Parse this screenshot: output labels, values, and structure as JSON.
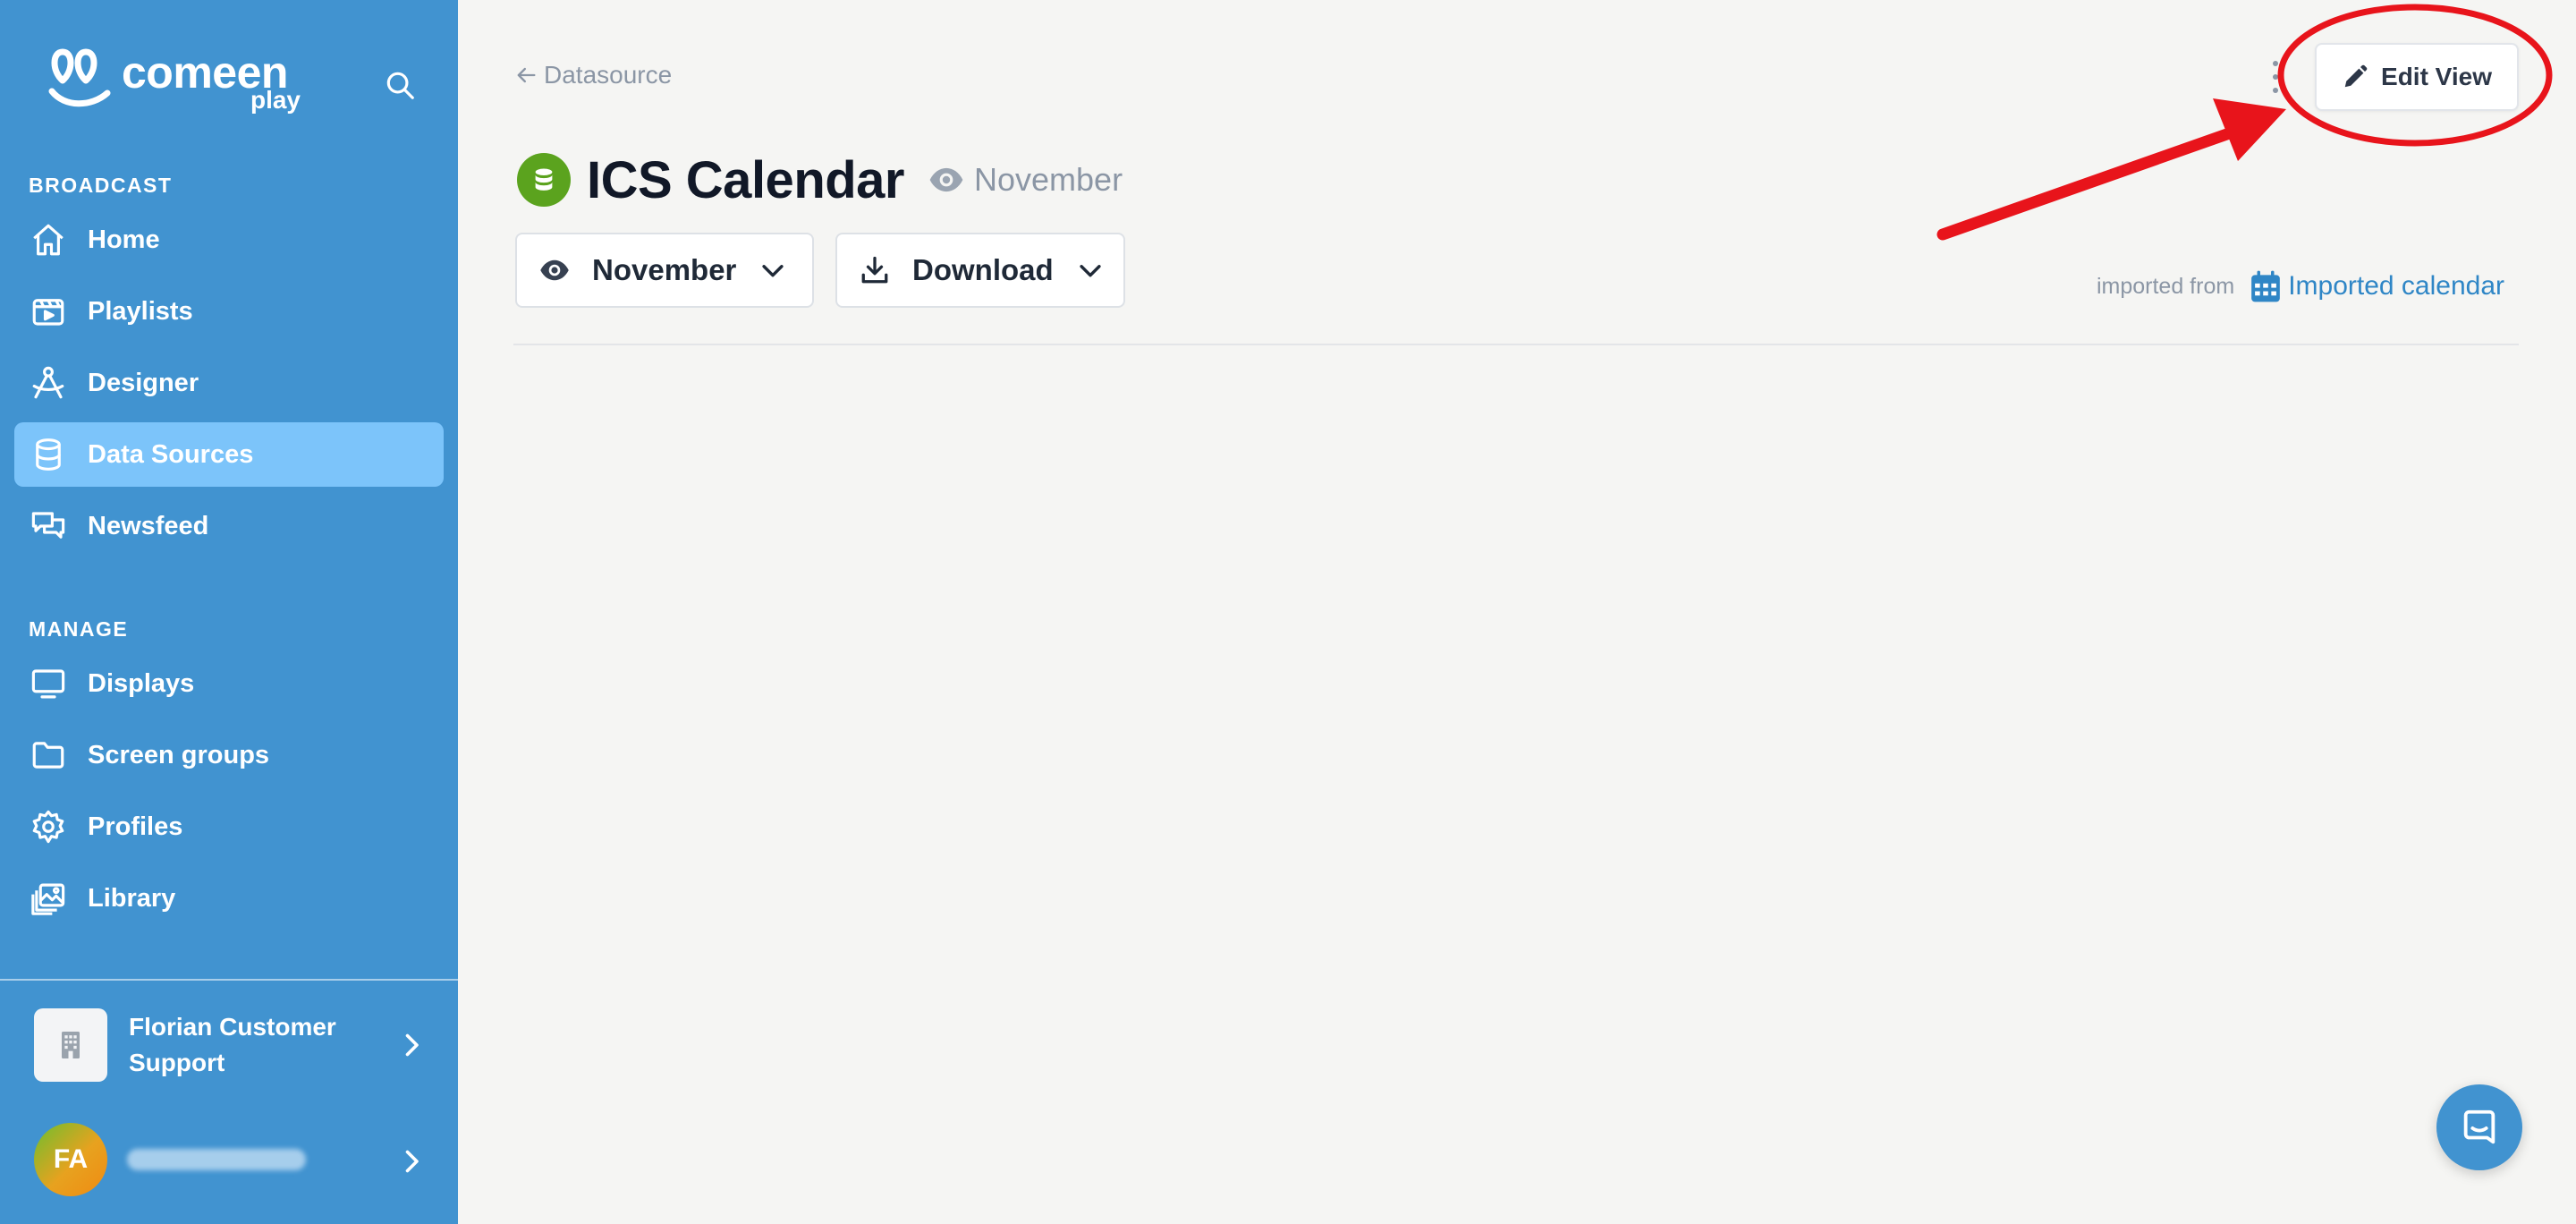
{
  "brand": {
    "name": "comeen",
    "product": "play"
  },
  "sidebar": {
    "sections": [
      {
        "label": "BROADCAST",
        "items": [
          {
            "label": "Home",
            "icon": "home-icon",
            "active": false
          },
          {
            "label": "Playlists",
            "icon": "playlist-icon",
            "active": false
          },
          {
            "label": "Designer",
            "icon": "designer-icon",
            "active": false
          },
          {
            "label": "Data Sources",
            "icon": "database-icon",
            "active": true
          },
          {
            "label": "Newsfeed",
            "icon": "chat-bubbles-icon",
            "active": false
          }
        ]
      },
      {
        "label": "MANAGE",
        "items": [
          {
            "label": "Displays",
            "icon": "monitor-icon",
            "active": false
          },
          {
            "label": "Screen groups",
            "icon": "folder-icon",
            "active": false
          },
          {
            "label": "Profiles",
            "icon": "gear-icon",
            "active": false
          },
          {
            "label": "Library",
            "icon": "image-library-icon",
            "active": false
          }
        ]
      }
    ],
    "organization": {
      "name": "Florian Customer Support",
      "icon": "building-icon"
    },
    "user": {
      "initials": "FA"
    }
  },
  "header": {
    "back_label": "Datasource",
    "edit_view_label": "Edit View"
  },
  "datasource": {
    "title": "ICS Calendar",
    "current_view": "November",
    "view_select_label": "November",
    "download_label": "Download",
    "imported_prefix": "imported from",
    "imported_link": "Imported calendar"
  },
  "colors": {
    "sidebar_bg": "#4193d0",
    "active_item_bg": "#7cc4fa",
    "page_bg": "#f5f5f3",
    "datasource_badge": "#5ba31e",
    "link": "#2f86c6",
    "annotation_red": "#e8141b"
  }
}
